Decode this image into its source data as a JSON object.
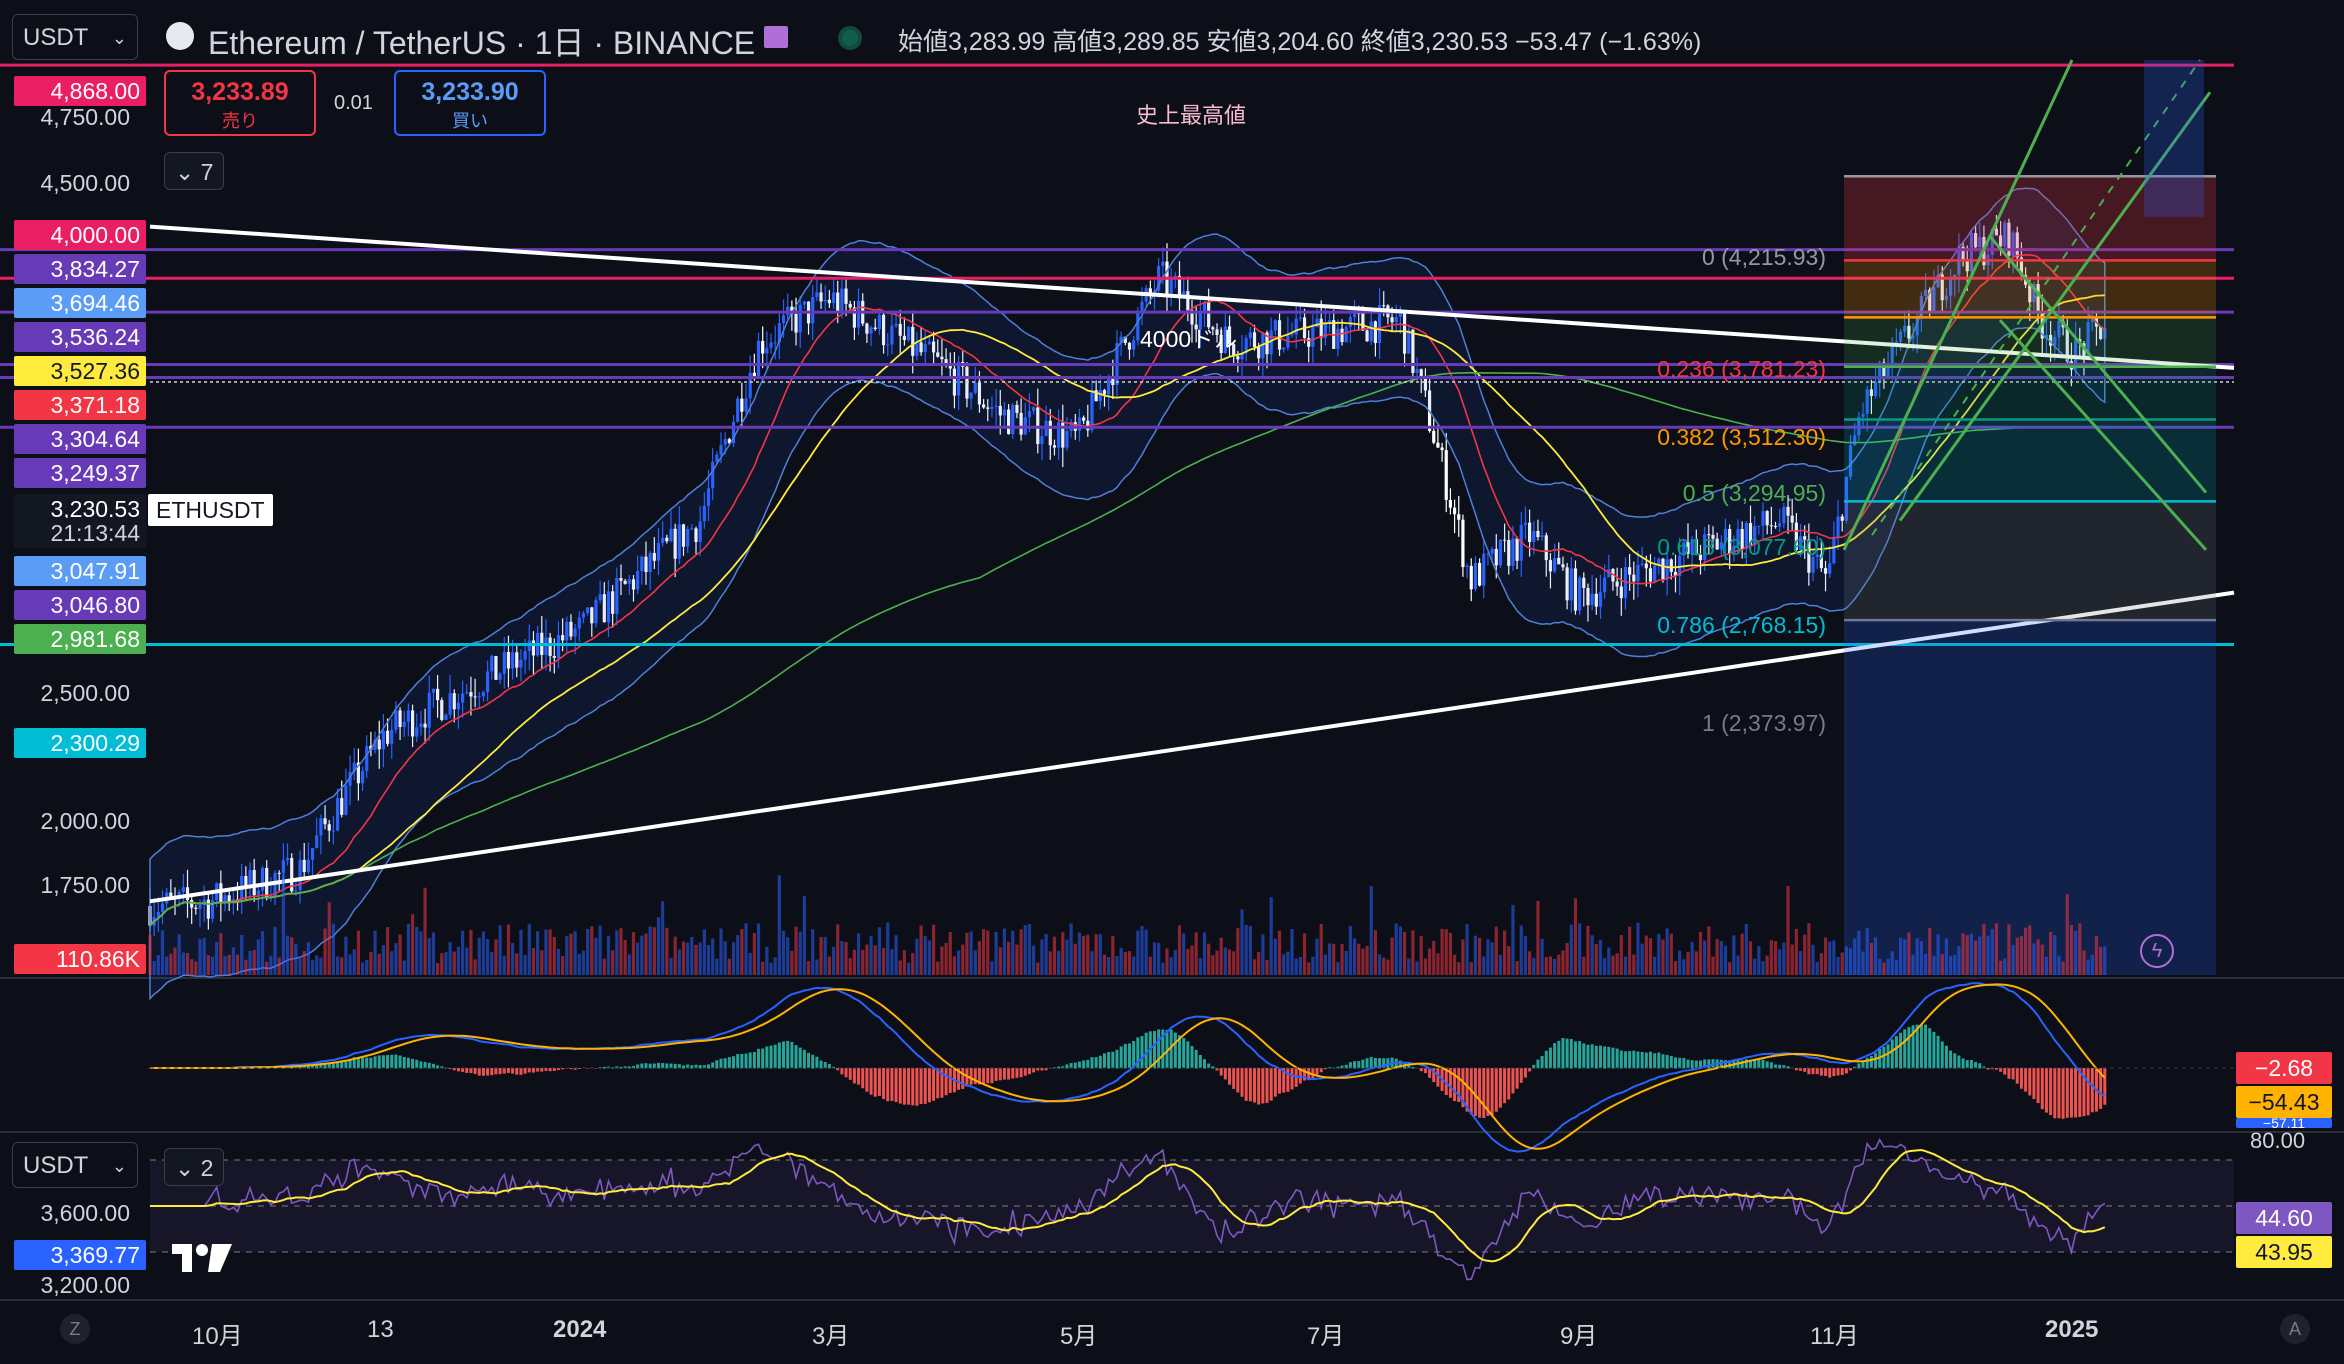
{
  "header": {
    "symbol_button": "USDT",
    "title": "Ethereum / TetherUS · 1日 · BINANCE",
    "ohlc": "始値3,283.99  高値3,289.85  安値3,204.60  終値3,230.53  −53.47 (−1.63%)",
    "sell_price": "3,233.89",
    "sell_label": "売り",
    "spread": "0.01",
    "buy_price": "3,233.90",
    "buy_label": "買い",
    "collapse_indicators": "7",
    "collapse_indicators_lower": "2"
  },
  "price_axis": {
    "ticks": [
      "4,750.00",
      "4,500.00",
      "2,500.00",
      "2,000.00",
      "1,750.00"
    ],
    "tags": [
      {
        "text": "4,868.00",
        "color": "#e91e63"
      },
      {
        "text": "4,000.00",
        "color": "#e91e63"
      },
      {
        "text": "3,834.27",
        "color": "#673ab7"
      },
      {
        "text": "3,694.46",
        "color": "#5b9cf6"
      },
      {
        "text": "3,536.24",
        "color": "#673ab7"
      },
      {
        "text": "3,527.36",
        "color": "#ffeb3b"
      },
      {
        "text": "3,371.18",
        "color": "#f23645"
      },
      {
        "text": "3,304.64",
        "color": "#673ab7"
      },
      {
        "text": "3,249.37",
        "color": "#673ab7"
      },
      {
        "text": "3,230.53",
        "color": "#ffffff"
      },
      {
        "text": "21:13:44",
        "color": "#ffffff"
      },
      {
        "text": "3,047.91",
        "color": "#5b9cf6"
      },
      {
        "text": "3,046.80",
        "color": "#673ab7"
      },
      {
        "text": "2,981.68",
        "color": "#4caf50"
      },
      {
        "text": "2,300.29",
        "color": "#00bcd4"
      },
      {
        "text": "110.86K",
        "color": "#f23645"
      }
    ],
    "symbol_tag": "ETHUSDT"
  },
  "annotations": {
    "ath_label": "史上最高値",
    "level_4000": "4000ドル",
    "fib": [
      {
        "text": "0 (4,215.93)",
        "color": "#9598a1"
      },
      {
        "text": "0.236 (3,781.23)",
        "color": "#f23645"
      },
      {
        "text": "0.382 (3,512.30)",
        "color": "#ff9800"
      },
      {
        "text": "0.5 (3,294.95)",
        "color": "#4caf50"
      },
      {
        "text": "0.618 (3,077.60)",
        "color": "#089981"
      },
      {
        "text": "0.786 (2,768.15)",
        "color": "#00bcd4"
      },
      {
        "text": "1 (2,373.97)",
        "color": "#787b86"
      }
    ]
  },
  "macd_panel": {
    "values": [
      {
        "text": "−2.68",
        "color": "#f23645"
      },
      {
        "text": "−54.43",
        "color": "#ffb300"
      },
      {
        "text": "−57.11",
        "color": "#2962ff"
      }
    ]
  },
  "rsi_panel": {
    "symbol_button": "USDT",
    "axis_ticks": [
      "3,600.00",
      "3,200.00"
    ],
    "level": "80.00",
    "price_tag": "3,369.77",
    "values": [
      {
        "text": "44.60",
        "color": "#7e57c2"
      },
      {
        "text": "43.95",
        "color": "#ffeb3b"
      }
    ]
  },
  "time_axis": {
    "labels": [
      "10月",
      "13",
      "2024",
      "3月",
      "5月",
      "7月",
      "9月",
      "11月",
      "2025"
    ],
    "left_button": "Z",
    "right_button": "A"
  },
  "chart_data": {
    "type": "candlestick",
    "symbol": "ETHUSDT",
    "interval": "1日",
    "exchange": "BINANCE",
    "last": {
      "open": 3283.99,
      "high": 3289.85,
      "low": 3204.6,
      "close": 3230.53,
      "change": -53.47,
      "change_pct": -1.63
    },
    "x_labels": [
      "10月",
      "13",
      "2024",
      "3月",
      "5月",
      "7月",
      "9月",
      "11月",
      "2025"
    ],
    "ylim": [
      1500,
      4900
    ],
    "scale": "log",
    "close_path": [
      {
        "x": "10月",
        "y": 1650
      },
      {
        "x": "13",
        "y": 2050
      },
      {
        "x": "2024",
        "y": 2350
      },
      {
        "x": "3月",
        "y": 3600
      },
      {
        "x": "5月",
        "y": 3000
      },
      {
        "x": "7月",
        "y": 3450
      },
      {
        "x": "9月",
        "y": 2450
      },
      {
        "x": "11月",
        "y": 2500
      },
      {
        "x": "2025",
        "y": 3350
      }
    ],
    "horizontal_levels": [
      4868.0,
      3834.27,
      3694.46,
      3536.24,
      3304.64,
      3249.37,
      3046.8,
      2300.29
    ],
    "fibonacci": [
      {
        "ratio": 0,
        "price": 4215.93
      },
      {
        "ratio": 0.236,
        "price": 3781.23
      },
      {
        "ratio": 0.382,
        "price": 3512.3
      },
      {
        "ratio": 0.5,
        "price": 3294.95
      },
      {
        "ratio": 0.618,
        "price": 3077.6
      },
      {
        "ratio": 0.786,
        "price": 2768.15
      },
      {
        "ratio": 1,
        "price": 2373.97
      }
    ],
    "volume_last": "110.86K",
    "macd": {
      "histogram": -2.68,
      "signal": -54.43,
      "macd": -57.11
    },
    "rsi": {
      "rsi": 44.6,
      "ma": 43.95,
      "upper": 80.0
    }
  }
}
